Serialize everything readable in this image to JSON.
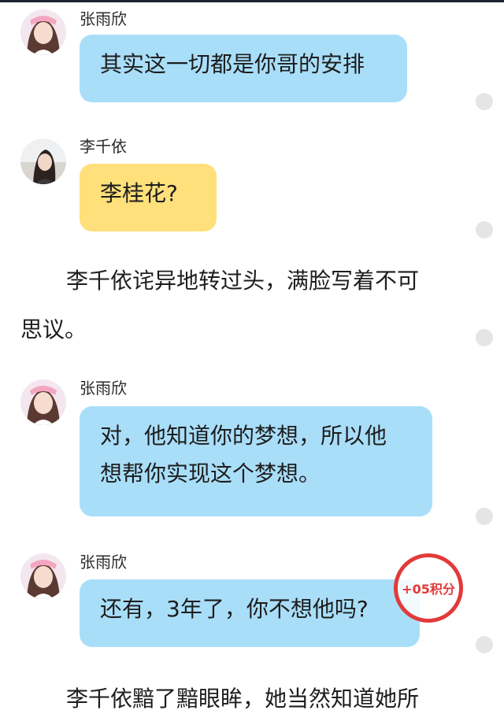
{
  "messages": [
    {
      "sender": "张雨欣",
      "lines": [
        "其实这一切都是你哥的安排"
      ],
      "color": "#a9def9"
    },
    {
      "sender": "李千依",
      "lines": [
        "李桂花?"
      ],
      "color": "#ffe07a"
    },
    {
      "sender": "张雨欣",
      "lines": [
        "对，他知道你的梦想，所以他",
        "想帮你实现这个梦想。"
      ],
      "color": "#a9def9"
    },
    {
      "sender": "张雨欣",
      "lines": [
        "还有，3年了，你不想他吗?"
      ],
      "color": "#a9def9"
    }
  ],
  "narration": [
    {
      "lines": [
        "李千依诧异地转过头，满脸写着不可",
        "思议。"
      ]
    },
    {
      "lines": [
        "李千依黯了黯眼眸，她当然知道她所"
      ]
    }
  ],
  "badge": {
    "text": "+05积分",
    "color": "#e23a3a"
  },
  "icons": {
    "avatar_a": "girl-avatar-icon",
    "avatar_b": "girl-avatar-icon",
    "dot": "circle-dot-icon"
  }
}
